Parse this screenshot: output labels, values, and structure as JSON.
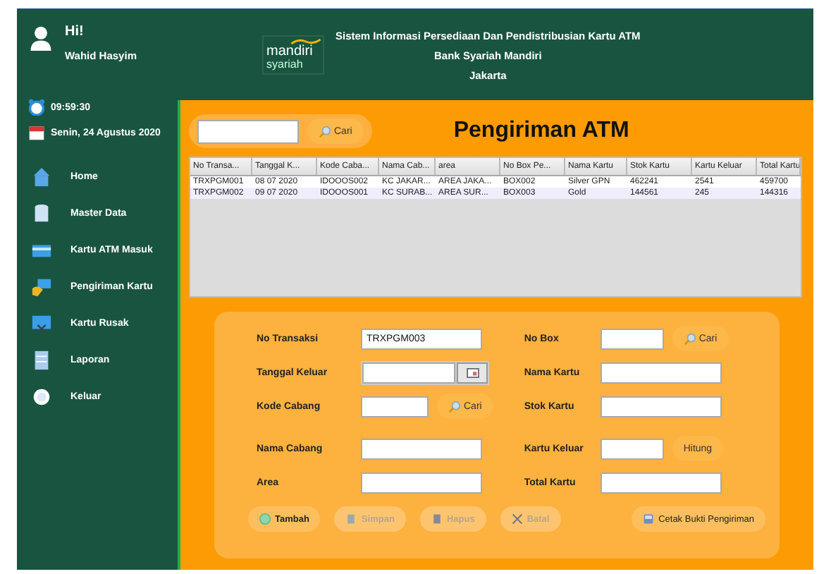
{
  "user": {
    "greeting": "Hi!",
    "name": "Wahid Hasyim"
  },
  "clock": {
    "time": "09:59:30",
    "date": "Senin, 24 Agustus 2020"
  },
  "menu": [
    {
      "label": "Home"
    },
    {
      "label": "Master Data"
    },
    {
      "label": "Kartu ATM Masuk"
    },
    {
      "label": "Pengiriman Kartu"
    },
    {
      "label": "Kartu Rusak"
    },
    {
      "label": "Laporan"
    },
    {
      "label": "Keluar"
    }
  ],
  "header": {
    "logo_main": "mandiri",
    "logo_sub": "syariah",
    "lines": [
      "Sistem Informasi Persediaan Dan Pendistribusian Kartu ATM",
      "Bank Syariah Mandiri",
      "Jakarta"
    ]
  },
  "search": {
    "button": "Cari"
  },
  "page_title": "Pengiriman ATM",
  "table": {
    "columns": [
      "No Transa...",
      "Tanggal K...",
      "Kode Caba...",
      "Nama Cab...",
      "area",
      "No Box Pe...",
      "Nama Kartu",
      "Stok Kartu",
      "Kartu Keluar",
      "Total Kartu"
    ],
    "rows": [
      [
        "TRXPGM001",
        "08 07 2020",
        "IDOOOS002",
        "KC JAKAR...",
        "AREA JAKA...",
        "BOX002",
        "Silver GPN",
        "462241",
        "2541",
        "459700"
      ],
      [
        "TRXPGM002",
        "09 07 2020",
        "IDOOOS001",
        "KC SURAB...",
        "AREA SUR...",
        "BOX003",
        "Gold",
        "144561",
        "245",
        "144316"
      ]
    ]
  },
  "form": {
    "left": [
      {
        "label": "No Transaksi",
        "kind": "wide",
        "value": "TRXPGM003"
      },
      {
        "label": "Tanggal Keluar",
        "kind": "date"
      },
      {
        "label": "Kode Cabang",
        "kind": "search",
        "button": "Cari"
      },
      {
        "label": "Nama Cabang",
        "kind": "wide"
      },
      {
        "label": "Area",
        "kind": "wide"
      }
    ],
    "right": [
      {
        "label": "No Box",
        "kind": "search",
        "button": "Cari"
      },
      {
        "label": "Nama Kartu",
        "kind": "wide"
      },
      {
        "label": "Stok Kartu",
        "kind": "wide"
      },
      {
        "label": "Kartu Keluar",
        "kind": "action",
        "button": "Hitung"
      },
      {
        "label": "Total Kartu",
        "kind": "wide"
      }
    ]
  },
  "buttons": [
    {
      "label": "Tambah",
      "disabled": false
    },
    {
      "label": "Simpan",
      "disabled": true
    },
    {
      "label": "Hapus",
      "disabled": true
    },
    {
      "label": "Batal",
      "disabled": true
    },
    {
      "label": "Cetak Bukti Pengiriman",
      "disabled": false
    }
  ]
}
